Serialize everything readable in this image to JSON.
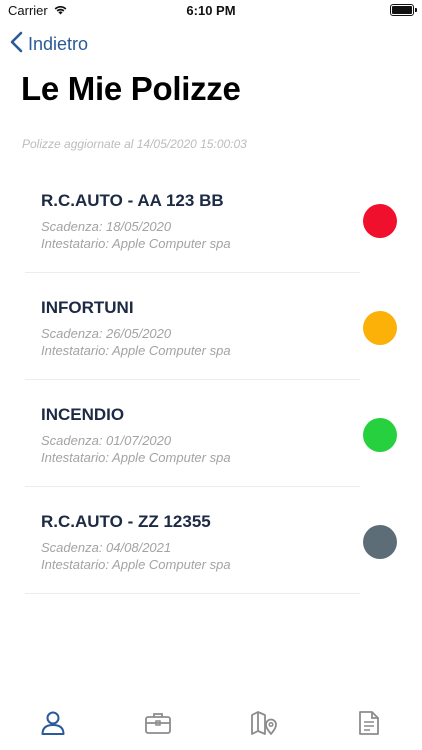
{
  "status_bar": {
    "carrier": "Carrier",
    "time": "6:10 PM"
  },
  "nav": {
    "back_label": "Indietro"
  },
  "page": {
    "title": "Le Mie Polizze",
    "updated_note": "Polizze aggiornate al 14/05/2020 15:00:03"
  },
  "policies": [
    {
      "name": "R.C.AUTO - AA 123 BB",
      "expiry": "Scadenza: 18/05/2020",
      "holder": "Intestatario:  Apple Computer spa",
      "status_color": "#f0102e"
    },
    {
      "name": "INFORTUNI",
      "expiry": "Scadenza: 26/05/2020",
      "holder": "Intestatario:  Apple Computer spa",
      "status_color": "#fbb107"
    },
    {
      "name": "INCENDIO",
      "expiry": "Scadenza: 01/07/2020",
      "holder": "Intestatario:  Apple Computer spa",
      "status_color": "#26d03f"
    },
    {
      "name": "R.C.AUTO - ZZ 12355",
      "expiry": "Scadenza: 04/08/2021",
      "holder": "Intestatario:  Apple Computer spa",
      "status_color": "#5c6d78"
    }
  ],
  "tab_bar": {
    "items": [
      {
        "icon": "user-icon",
        "active": true
      },
      {
        "icon": "briefcase-icon",
        "active": false
      },
      {
        "icon": "map-pin-icon",
        "active": false
      },
      {
        "icon": "document-icon",
        "active": false
      }
    ],
    "active_color": "#2a5a99",
    "inactive_color": "#8c8c8c"
  },
  "colors": {
    "accent": "#2a5a99",
    "title": "#000000",
    "policy_name": "#1c2a44",
    "secondary_text": "#a3a3a3"
  }
}
